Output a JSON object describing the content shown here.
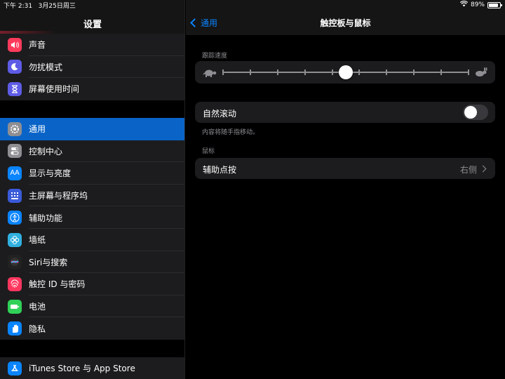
{
  "status": {
    "time": "下午 2:31",
    "date": "3月25日周三",
    "battery": "89%",
    "battery_level": 0.89
  },
  "sidebar": {
    "title": "设置",
    "group1": [
      {
        "label": "声音",
        "icon": "speaker-icon",
        "color": "#ff3b5c"
      },
      {
        "label": "勿扰模式",
        "icon": "moon-icon",
        "color": "#5e5ce6"
      },
      {
        "label": "屏幕使用时间",
        "icon": "hourglass-icon",
        "color": "#5e5ce6"
      }
    ],
    "group2": [
      {
        "label": "通用",
        "icon": "gear-icon",
        "color": "#8e8e93",
        "selected": true
      },
      {
        "label": "控制中心",
        "icon": "toggles-icon",
        "color": "#8e8e93"
      },
      {
        "label": "显示与亮度",
        "icon": "text-size-icon",
        "color": "#0a84ff"
      },
      {
        "label": "主屏幕与程序坞",
        "icon": "grid-icon",
        "color": "#3a5bd9"
      },
      {
        "label": "辅助功能",
        "icon": "accessibility-icon",
        "color": "#0a84ff"
      },
      {
        "label": "墙纸",
        "icon": "flower-icon",
        "color": "#30b0e0"
      },
      {
        "label": "Siri与搜索",
        "icon": "siri-icon",
        "color": "#222222"
      },
      {
        "label": "触控 ID 与密码",
        "icon": "fingerprint-icon",
        "color": "#ff375f"
      },
      {
        "label": "电池",
        "icon": "battery-icon",
        "color": "#30d158"
      },
      {
        "label": "隐私",
        "icon": "hand-icon",
        "color": "#0a84ff"
      }
    ],
    "group3": [
      {
        "label": "iTunes Store 与 App Store",
        "icon": "app-store-icon",
        "color": "#0a84ff"
      }
    ]
  },
  "detail": {
    "back_label": "通用",
    "title": "触控板与鼠标",
    "tracking": {
      "section": "跟踪速度",
      "ticks": 10,
      "value_index": 4
    },
    "natural_scroll": {
      "label": "自然滚动",
      "enabled": false,
      "footnote": "内容将随手指移动。"
    },
    "mouse": {
      "section": "鼠标",
      "secondary_click_label": "辅助点按",
      "secondary_click_value": "右侧"
    }
  }
}
